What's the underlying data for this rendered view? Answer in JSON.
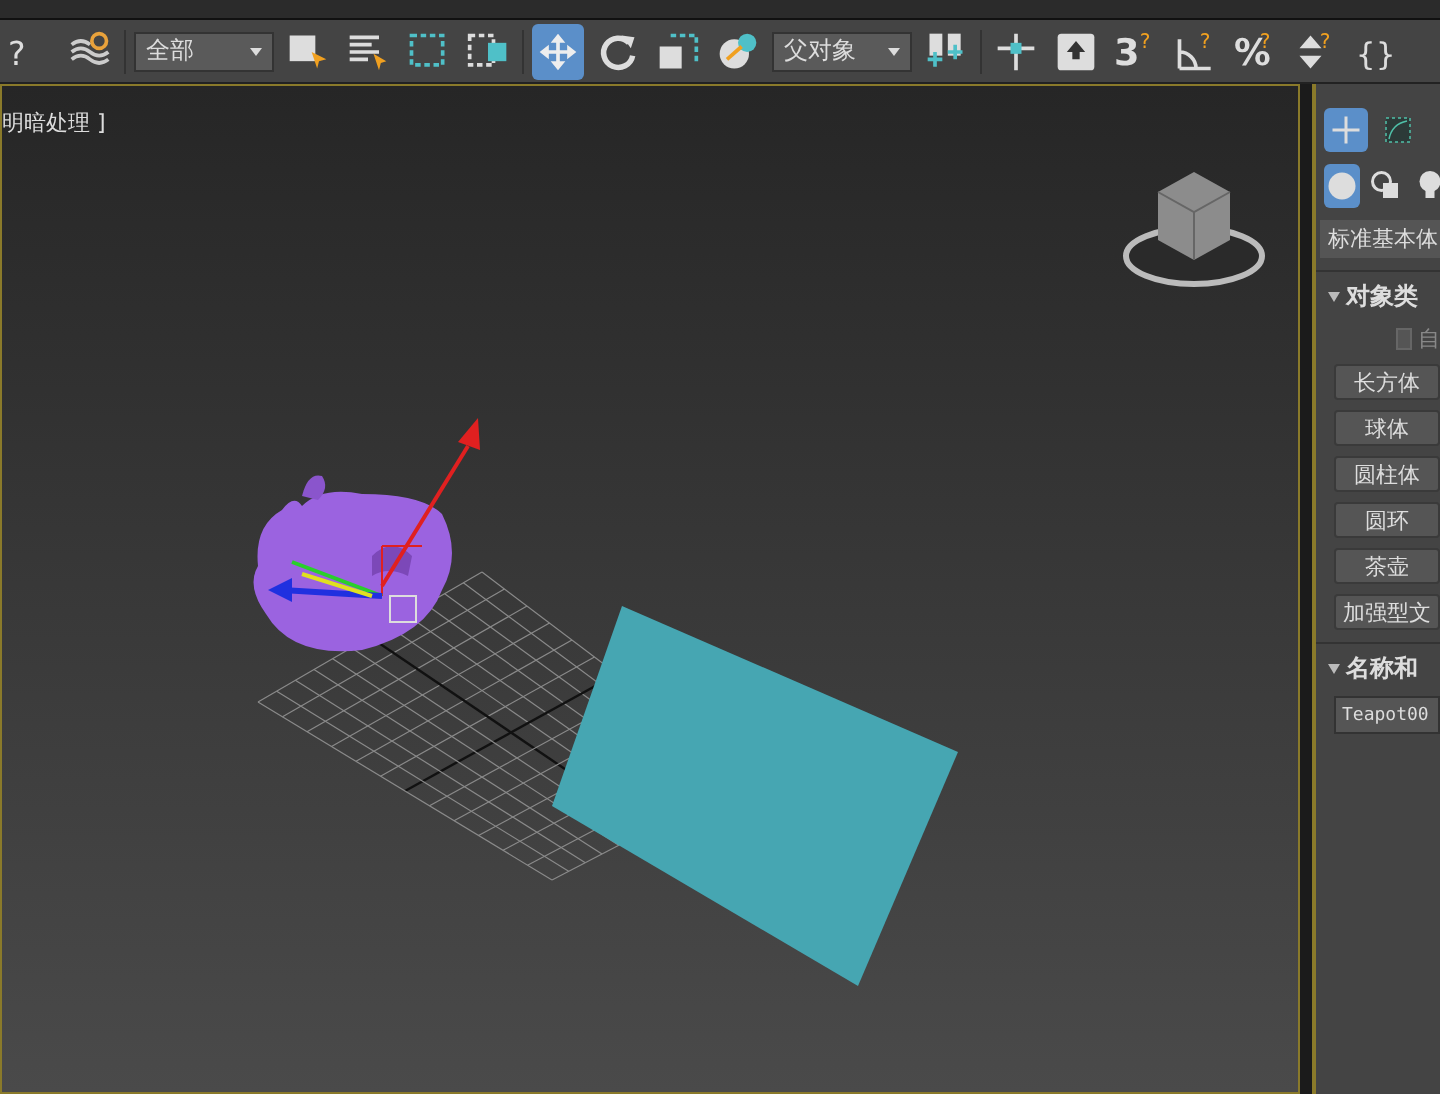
{
  "toolbar": {
    "tools": [
      {
        "kind": "help",
        "selected": false,
        "glyph": "?"
      },
      {
        "kind": "bind",
        "selected": false
      },
      {
        "kind": "dropdown",
        "value": "全部"
      },
      {
        "kind": "select",
        "selected": false
      },
      {
        "kind": "select-by-name",
        "selected": false
      },
      {
        "kind": "rect-region",
        "selected": false
      },
      {
        "kind": "window-crossing",
        "selected": false
      },
      {
        "kind": "move",
        "selected": true
      },
      {
        "kind": "rotate",
        "selected": false
      },
      {
        "kind": "scale",
        "selected": false
      },
      {
        "kind": "place",
        "selected": false
      },
      {
        "kind": "dropdown",
        "value": "父对象"
      },
      {
        "kind": "pivot",
        "selected": false
      },
      {
        "kind": "manipulate",
        "selected": false
      },
      {
        "kind": "shortcut",
        "selected": false
      },
      {
        "kind": "snap",
        "selected": false,
        "glyph": "3",
        "badge": "?"
      },
      {
        "kind": "angle-snap",
        "selected": false,
        "badge": "?"
      },
      {
        "kind": "percent-snap",
        "selected": false,
        "glyph": "%",
        "badge": "?"
      },
      {
        "kind": "spinner-snap",
        "selected": false,
        "badge": "?"
      },
      {
        "kind": "braces",
        "selected": false,
        "glyph": "{}"
      }
    ]
  },
  "viewport": {
    "label": "明暗处理 ]",
    "active": true
  },
  "command_panel": {
    "tabs": [
      {
        "kind": "create",
        "selected": true
      },
      {
        "kind": "modify",
        "selected": false
      }
    ],
    "categories": [
      {
        "kind": "geometry",
        "selected": true
      },
      {
        "kind": "shapes",
        "selected": false
      },
      {
        "kind": "lights",
        "selected": false
      }
    ],
    "type_dropdown": "标准基本体",
    "rollouts": [
      {
        "title": "对象类",
        "expanded": true,
        "checkbox": {
          "label": "自",
          "checked": false
        },
        "buttons": [
          "长方体",
          "球体",
          "圆柱体",
          "圆环",
          "茶壶",
          "加强型文"
        ]
      },
      {
        "title": "名称和",
        "expanded": true,
        "name_field": "Teapot00"
      }
    ]
  }
}
